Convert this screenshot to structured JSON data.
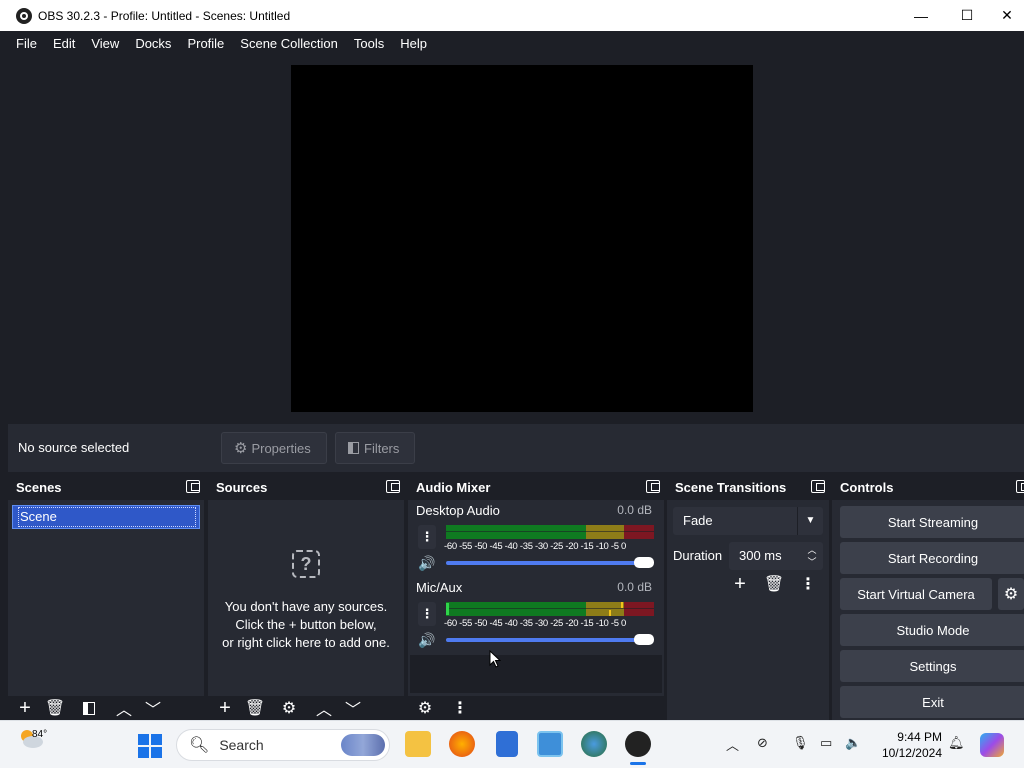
{
  "window": {
    "title": "OBS 30.2.3 - Profile: Untitled - Scenes: Untitled",
    "min": "—",
    "max": "☐",
    "close": "✕"
  },
  "menu": [
    "File",
    "Edit",
    "View",
    "Docks",
    "Profile",
    "Scene Collection",
    "Tools",
    "Help"
  ],
  "context": {
    "no_source": "No source selected",
    "properties": "Properties",
    "filters": "Filters"
  },
  "scenes": {
    "title": "Scenes",
    "items": [
      "Scene"
    ]
  },
  "sources": {
    "title": "Sources",
    "empty_line1": "You don't have any sources.",
    "empty_line2": "Click the + button below,",
    "empty_line3": "or right click here to add one."
  },
  "mixer": {
    "title": "Audio Mixer",
    "scale": "-60 -55 -50 -45 -40 -35 -30 -25 -20 -15 -10  -5   0",
    "channels": [
      {
        "name": "Desktop Audio",
        "db": "0.0 dB",
        "volume": 1.0
      },
      {
        "name": "Mic/Aux",
        "db": "0.0 dB",
        "volume": 1.0
      }
    ]
  },
  "transitions": {
    "title": "Scene Transitions",
    "selected": "Fade",
    "duration_label": "Duration",
    "duration_value": "300 ms"
  },
  "controls": {
    "title": "Controls",
    "start_streaming": "Start Streaming",
    "start_recording": "Start Recording",
    "start_virtual_camera": "Start Virtual Camera",
    "studio_mode": "Studio Mode",
    "settings": "Settings",
    "exit": "Exit"
  },
  "taskbar": {
    "weather": "84°",
    "search_placeholder": "Search",
    "time": "9:44 PM",
    "date": "10/12/2024"
  },
  "colors": {
    "bg": "#1d1f26",
    "panel": "#272a33",
    "button": "#3c404b",
    "accent": "#2f58c8",
    "meter_green": "#0f7a21",
    "meter_yellow": "#8e7d18",
    "meter_red": "#7d1722"
  }
}
